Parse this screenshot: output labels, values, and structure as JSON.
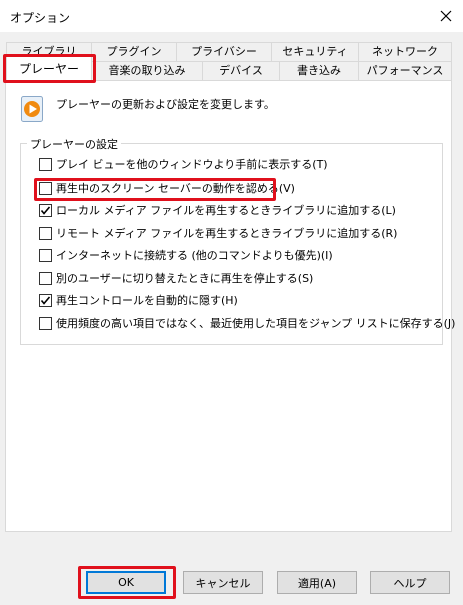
{
  "window": {
    "title": "オプション"
  },
  "tabs": {
    "row1": [
      "ライブラリ",
      "プラグイン",
      "プライバシー",
      "セキュリティ",
      "ネットワーク"
    ],
    "row2": [
      "音楽の取り込み",
      "デバイス",
      "書き込み",
      "パフォーマンス"
    ],
    "active": "プレーヤー"
  },
  "description": "プレーヤーの更新および設定を変更します。",
  "settings": {
    "group_label": "プレーヤーの設定",
    "items": [
      {
        "label": "プレイ ビューを他のウィンドウより手前に表示する(T)",
        "checked": false
      },
      {
        "label": "再生中のスクリーン セーバーの動作を認める(V)",
        "checked": false
      },
      {
        "label": "ローカル メディア ファイルを再生するときライブラリに追加する(L)",
        "checked": true
      },
      {
        "label": "リモート メディア ファイルを再生するときライブラリに追加する(R)",
        "checked": false
      },
      {
        "label": "インターネットに接続する (他のコマンドよりも優先)(I)",
        "checked": false
      },
      {
        "label": "別のユーザーに切り替えたときに再生を停止する(S)",
        "checked": false
      },
      {
        "label": "再生コントロールを自動的に隠す(H)",
        "checked": true
      },
      {
        "label": "使用頻度の高い項目ではなく、最近使用した項目をジャンプ リストに保存する(J)",
        "checked": false
      }
    ]
  },
  "buttons": {
    "ok": "OK",
    "cancel": "キャンセル",
    "apply": "適用(A)",
    "help": "ヘルプ"
  },
  "colors": {
    "highlight": "#e0101c",
    "accent": "#0078d7",
    "check": "#000000"
  }
}
